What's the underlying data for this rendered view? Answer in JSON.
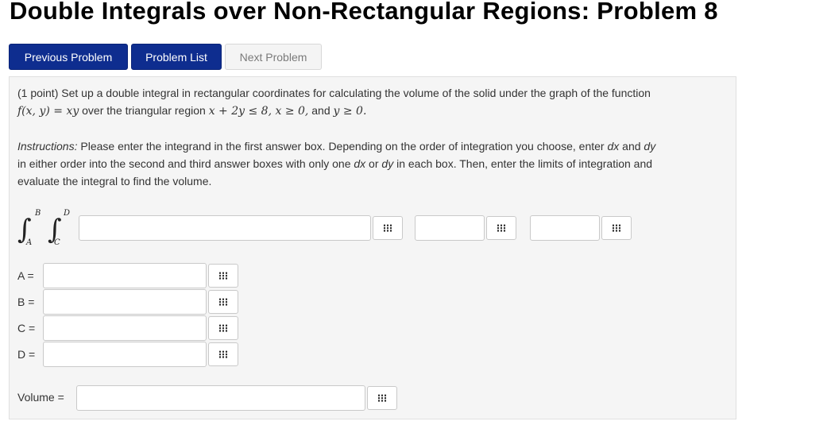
{
  "page_title": "Double Integrals over Non-Rectangular Regions: Problem 8",
  "nav": {
    "previous": "Previous Problem",
    "list": "Problem List",
    "next": "Next Problem"
  },
  "problem": {
    "line1": "(1 point) Set up a double integral in rectangular coordinates for calculating the volume of the solid under the graph of the function",
    "func": "f(x, y) = xy",
    "over": " over the triangular region ",
    "region": "x + 2y ≤ 8, x ≥ 0,",
    "and": " and ",
    "ycond": "y ≥ 0.",
    "instructions_label": "Instructions:",
    "instructions_line1": " Please enter the integrand in the first answer box. Depending on the order of integration you choose, enter ",
    "dx": "dx",
    "and2": " and ",
    "dy": "dy",
    "instructions_line2a": "in either order into the second and third answer boxes with only one ",
    "dx2": "dx",
    "or": " or ",
    "dy2": "dy",
    "instructions_line2b": " in each box. Then, enter the limits of integration and",
    "instructions_line3": "evaluate the integral to find the volume."
  },
  "integral": {
    "upper_outer": "B",
    "lower_outer": "A",
    "upper_inner": "D",
    "lower_inner": "C"
  },
  "labels": {
    "a": "A =",
    "b": "B =",
    "c": "C =",
    "d": "D =",
    "volume": "Volume ="
  }
}
